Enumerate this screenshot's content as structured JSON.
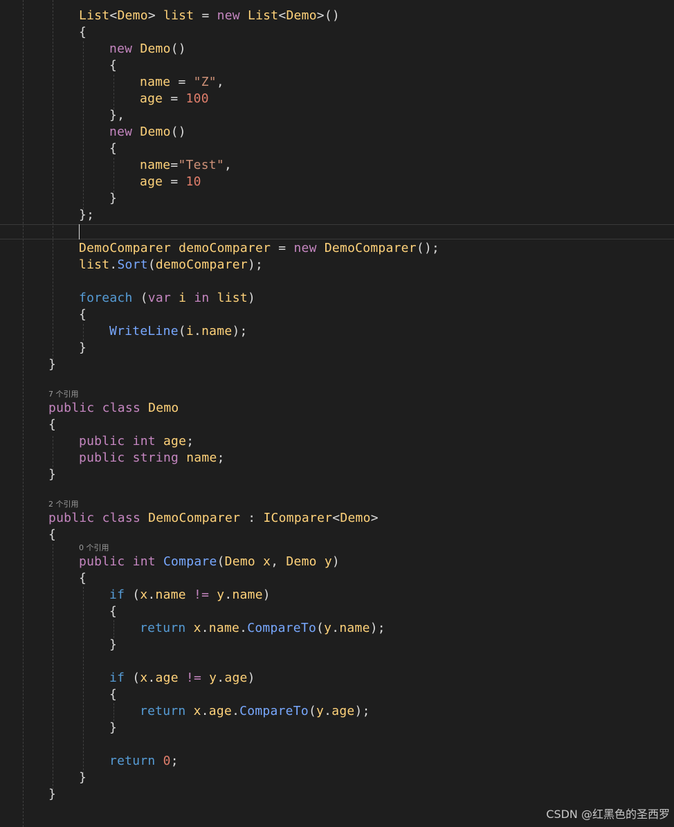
{
  "colors": {
    "background": "#1e1e1e",
    "keyword": "#c586c0",
    "keyword_blue": "#569cd6",
    "identifier": "#ffd27a",
    "string": "#ce9178",
    "number": "#e07e6b",
    "method": "#78a8ff",
    "punctuation": "#dcdcdc"
  },
  "code_lines": [
    {
      "indent": 2,
      "tokens": [
        [
          "List",
          "var"
        ],
        [
          "<",
          "op"
        ],
        [
          "Demo",
          "var"
        ],
        [
          "> ",
          "op"
        ],
        [
          "list",
          "var"
        ],
        [
          " = ",
          "op"
        ],
        [
          "new ",
          "kw"
        ],
        [
          "List",
          "var"
        ],
        [
          "<",
          "op"
        ],
        [
          "Demo",
          "var"
        ],
        [
          ">()",
          "op"
        ]
      ]
    },
    {
      "indent": 2,
      "tokens": [
        [
          "{",
          "punc"
        ]
      ]
    },
    {
      "indent": 3,
      "tokens": [
        [
          "new ",
          "kw"
        ],
        [
          "Demo",
          "var"
        ],
        [
          "()",
          "punc"
        ]
      ]
    },
    {
      "indent": 3,
      "tokens": [
        [
          "{",
          "punc"
        ]
      ]
    },
    {
      "indent": 4,
      "tokens": [
        [
          "name",
          "var"
        ],
        [
          " = ",
          "op"
        ],
        [
          "\"Z\"",
          "str"
        ],
        [
          ",",
          "punc"
        ]
      ]
    },
    {
      "indent": 4,
      "tokens": [
        [
          "age",
          "var"
        ],
        [
          " = ",
          "op"
        ],
        [
          "100",
          "num"
        ]
      ]
    },
    {
      "indent": 3,
      "tokens": [
        [
          "},",
          "punc"
        ]
      ]
    },
    {
      "indent": 3,
      "tokens": [
        [
          "new ",
          "kw"
        ],
        [
          "Demo",
          "var"
        ],
        [
          "()",
          "punc"
        ]
      ]
    },
    {
      "indent": 3,
      "tokens": [
        [
          "{",
          "punc"
        ]
      ]
    },
    {
      "indent": 4,
      "tokens": [
        [
          "name",
          "var"
        ],
        [
          "=",
          "op"
        ],
        [
          "\"Test\"",
          "str"
        ],
        [
          ",",
          "punc"
        ]
      ]
    },
    {
      "indent": 4,
      "tokens": [
        [
          "age",
          "var"
        ],
        [
          " = ",
          "op"
        ],
        [
          "10",
          "num"
        ]
      ]
    },
    {
      "indent": 3,
      "tokens": [
        [
          "}",
          "punc"
        ]
      ]
    },
    {
      "indent": 2,
      "tokens": [
        [
          "};",
          "punc"
        ]
      ]
    },
    {
      "indent": 2,
      "tokens": []
    },
    {
      "indent": 2,
      "tokens": [
        [
          "DemoComparer ",
          "var"
        ],
        [
          "demoComparer",
          "var"
        ],
        [
          " = ",
          "op"
        ],
        [
          "new ",
          "kw"
        ],
        [
          "DemoComparer",
          "var"
        ],
        [
          "();",
          "punc"
        ]
      ]
    },
    {
      "indent": 2,
      "tokens": [
        [
          "list",
          "var"
        ],
        [
          ".",
          "punc"
        ],
        [
          "Sort",
          "method"
        ],
        [
          "(",
          "punc"
        ],
        [
          "demoComparer",
          "var"
        ],
        [
          ");",
          "punc"
        ]
      ]
    },
    {
      "indent": 2,
      "tokens": []
    },
    {
      "indent": 2,
      "tokens": [
        [
          "foreach ",
          "kb"
        ],
        [
          "(",
          "punc"
        ],
        [
          "var ",
          "kw"
        ],
        [
          "i ",
          "var"
        ],
        [
          "in ",
          "kw"
        ],
        [
          "list",
          "var"
        ],
        [
          ")",
          "punc"
        ]
      ]
    },
    {
      "indent": 2,
      "tokens": [
        [
          "{",
          "punc"
        ]
      ]
    },
    {
      "indent": 3,
      "tokens": [
        [
          "WriteLine",
          "method"
        ],
        [
          "(",
          "punc"
        ],
        [
          "i",
          "var"
        ],
        [
          ".",
          "punc"
        ],
        [
          "name",
          "var"
        ],
        [
          ");",
          "punc"
        ]
      ]
    },
    {
      "indent": 2,
      "tokens": [
        [
          "}",
          "punc"
        ]
      ]
    },
    {
      "indent": 1,
      "tokens": [
        [
          "}",
          "punc"
        ]
      ]
    },
    {
      "indent": 1,
      "tokens": [
        [
          "public ",
          "kw"
        ],
        [
          "class ",
          "kw"
        ],
        [
          "Demo",
          "var"
        ]
      ]
    },
    {
      "indent": 1,
      "tokens": [
        [
          "{",
          "punc"
        ]
      ]
    },
    {
      "indent": 2,
      "tokens": [
        [
          "public ",
          "kw"
        ],
        [
          "int ",
          "kw"
        ],
        [
          "age",
          "var"
        ],
        [
          ";",
          "punc"
        ]
      ]
    },
    {
      "indent": 2,
      "tokens": [
        [
          "public ",
          "kw"
        ],
        [
          "string ",
          "kw"
        ],
        [
          "name",
          "var"
        ],
        [
          ";",
          "punc"
        ]
      ]
    },
    {
      "indent": 1,
      "tokens": [
        [
          "}",
          "punc"
        ]
      ]
    },
    {
      "indent": 1,
      "tokens": [
        [
          "public ",
          "kw"
        ],
        [
          "class ",
          "kw"
        ],
        [
          "DemoComparer ",
          "var"
        ],
        [
          ": ",
          "op"
        ],
        [
          "IComparer",
          "var"
        ],
        [
          "<",
          "op"
        ],
        [
          "Demo",
          "var"
        ],
        [
          ">",
          "op"
        ]
      ]
    },
    {
      "indent": 1,
      "tokens": [
        [
          "{",
          "punc"
        ]
      ]
    },
    {
      "indent": 2,
      "tokens": [
        [
          "public ",
          "kw"
        ],
        [
          "int ",
          "kw"
        ],
        [
          "Compare",
          "method"
        ],
        [
          "(",
          "punc"
        ],
        [
          "Demo ",
          "var"
        ],
        [
          "x",
          "var"
        ],
        [
          ", ",
          "punc"
        ],
        [
          "Demo ",
          "var"
        ],
        [
          "y",
          "var"
        ],
        [
          ")",
          "punc"
        ]
      ]
    },
    {
      "indent": 2,
      "tokens": [
        [
          "{",
          "punc"
        ]
      ]
    },
    {
      "indent": 3,
      "tokens": [
        [
          "if ",
          "kb"
        ],
        [
          "(",
          "punc"
        ],
        [
          "x",
          "var"
        ],
        [
          ".",
          "punc"
        ],
        [
          "name ",
          "var"
        ],
        [
          "!= ",
          "kw"
        ],
        [
          "y",
          "var"
        ],
        [
          ".",
          "punc"
        ],
        [
          "name",
          "var"
        ],
        [
          ")",
          "punc"
        ]
      ]
    },
    {
      "indent": 3,
      "tokens": [
        [
          "{",
          "punc"
        ]
      ]
    },
    {
      "indent": 4,
      "tokens": [
        [
          "return ",
          "kb"
        ],
        [
          "x",
          "var"
        ],
        [
          ".",
          "punc"
        ],
        [
          "name",
          "var"
        ],
        [
          ".",
          "punc"
        ],
        [
          "CompareTo",
          "method"
        ],
        [
          "(",
          "punc"
        ],
        [
          "y",
          "var"
        ],
        [
          ".",
          "punc"
        ],
        [
          "name",
          "var"
        ],
        [
          ");",
          "punc"
        ]
      ]
    },
    {
      "indent": 3,
      "tokens": [
        [
          "}",
          "punc"
        ]
      ]
    },
    {
      "indent": 3,
      "tokens": []
    },
    {
      "indent": 3,
      "tokens": [
        [
          "if ",
          "kb"
        ],
        [
          "(",
          "punc"
        ],
        [
          "x",
          "var"
        ],
        [
          ".",
          "punc"
        ],
        [
          "age ",
          "var"
        ],
        [
          "!= ",
          "kw"
        ],
        [
          "y",
          "var"
        ],
        [
          ".",
          "punc"
        ],
        [
          "age",
          "var"
        ],
        [
          ")",
          "punc"
        ]
      ]
    },
    {
      "indent": 3,
      "tokens": [
        [
          "{",
          "punc"
        ]
      ]
    },
    {
      "indent": 4,
      "tokens": [
        [
          "return ",
          "kb"
        ],
        [
          "x",
          "var"
        ],
        [
          ".",
          "punc"
        ],
        [
          "age",
          "var"
        ],
        [
          ".",
          "punc"
        ],
        [
          "CompareTo",
          "method"
        ],
        [
          "(",
          "punc"
        ],
        [
          "y",
          "var"
        ],
        [
          ".",
          "punc"
        ],
        [
          "age",
          "var"
        ],
        [
          ");",
          "punc"
        ]
      ]
    },
    {
      "indent": 3,
      "tokens": [
        [
          "}",
          "punc"
        ]
      ]
    },
    {
      "indent": 3,
      "tokens": []
    },
    {
      "indent": 3,
      "tokens": [
        [
          "return ",
          "kb"
        ],
        [
          "0",
          "num"
        ],
        [
          ";",
          "punc"
        ]
      ]
    },
    {
      "indent": 2,
      "tokens": [
        [
          "}",
          "punc"
        ]
      ]
    },
    {
      "indent": 1,
      "tokens": [
        [
          "}",
          "punc"
        ]
      ]
    }
  ],
  "code_lens": {
    "demo_class_refs": "7 个引用",
    "comparer_class_refs": "2 个引用",
    "compare_method_refs": "0 个引用"
  },
  "watermark": "CSDN @红黑色的圣西罗"
}
